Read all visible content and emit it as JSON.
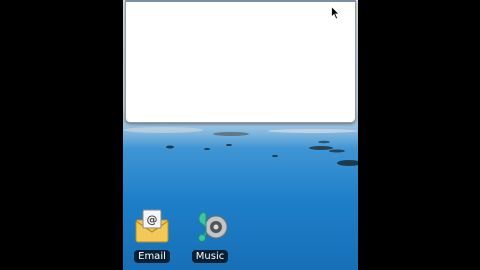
{
  "home_screen": {
    "widget": {
      "content": ""
    },
    "apps": [
      {
        "label": "Email",
        "icon": "email-icon"
      },
      {
        "label": "Music",
        "icon": "music-icon"
      }
    ]
  }
}
